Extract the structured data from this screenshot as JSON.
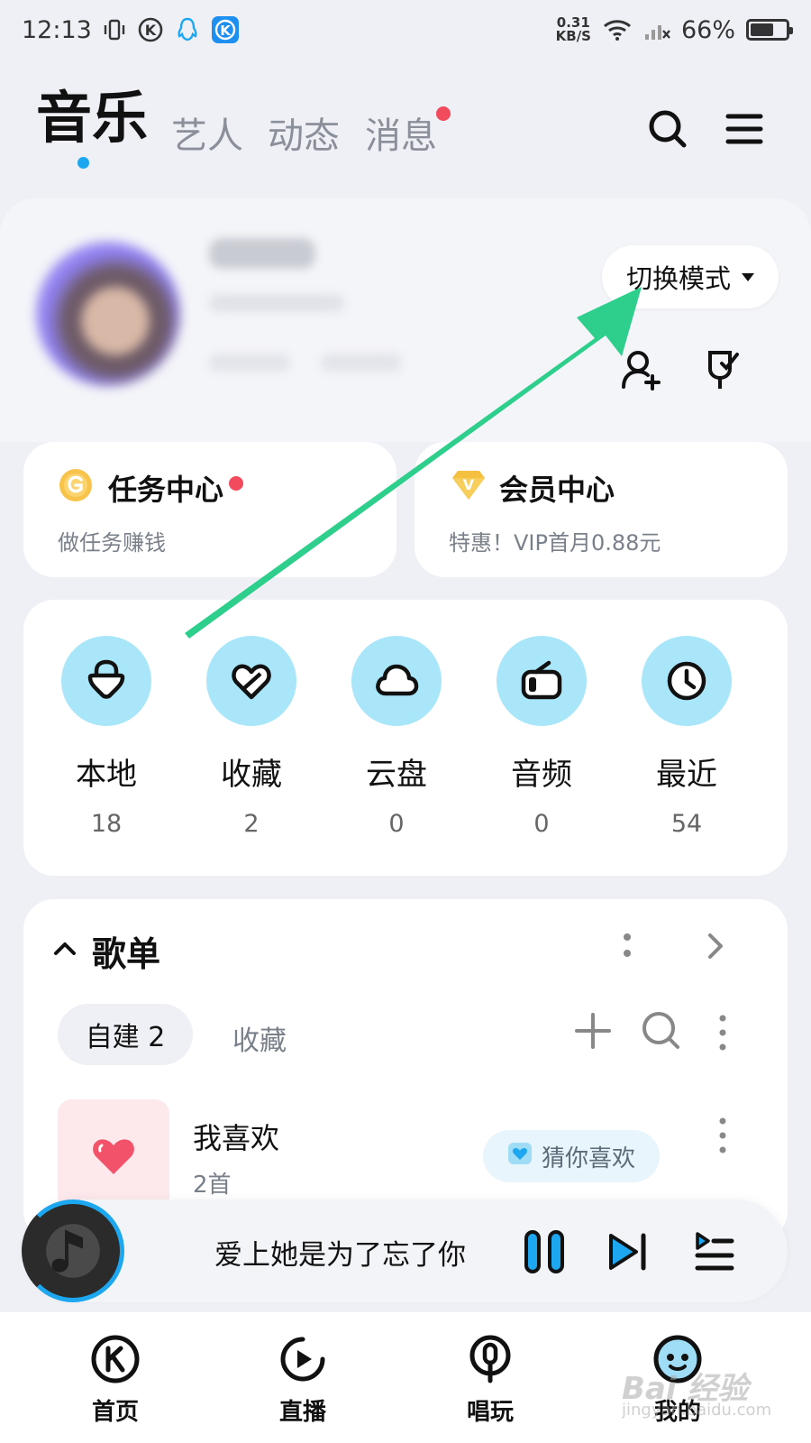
{
  "status_bar": {
    "time": "12:13",
    "net_speed_value": "0.31",
    "net_speed_unit": "KB/S",
    "battery": "66%",
    "battery_level": 0.66
  },
  "top_nav": {
    "tabs": [
      {
        "label": "音乐",
        "active": true
      },
      {
        "label": "艺人",
        "active": false
      },
      {
        "label": "动态",
        "active": false
      },
      {
        "label": "消息",
        "active": false,
        "has_dot": true
      }
    ],
    "accent_color": "#1da7f0"
  },
  "profile": {
    "mode_button": "切换模式"
  },
  "quick_cards": [
    {
      "title": "任务中心",
      "subtitle": "做任务赚钱",
      "icon": "coin-g-icon",
      "has_dot": true
    },
    {
      "title": "会员中心",
      "subtitle": "特惠！VIP首月0.88元",
      "icon": "vip-diamond-icon",
      "has_dot": false
    }
  ],
  "library": [
    {
      "label": "本地",
      "count": "18",
      "icon": "local-lock-icon"
    },
    {
      "label": "收藏",
      "count": "2",
      "icon": "heart-icon"
    },
    {
      "label": "云盘",
      "count": "0",
      "icon": "cloud-icon"
    },
    {
      "label": "音频",
      "count": "0",
      "icon": "radio-icon"
    },
    {
      "label": "最近",
      "count": "54",
      "icon": "clock-icon"
    }
  ],
  "playlist": {
    "title": "歌单",
    "tabs": [
      "自建 2",
      "收藏"
    ],
    "items": [
      {
        "name": "我喜欢",
        "count": "2首",
        "action": "猜你喜欢"
      }
    ]
  },
  "player": {
    "song_title": "爱上她是为了忘了你"
  },
  "bottom_nav": [
    {
      "label": "首页",
      "icon": "kugou-k-icon"
    },
    {
      "label": "直播",
      "icon": "live-play-icon"
    },
    {
      "label": "唱玩",
      "icon": "mic-icon"
    },
    {
      "label": "我的",
      "icon": "profile-face-icon"
    }
  ],
  "watermark": {
    "text": "Bai 经验",
    "sub": "jingyan.baidu.com"
  }
}
